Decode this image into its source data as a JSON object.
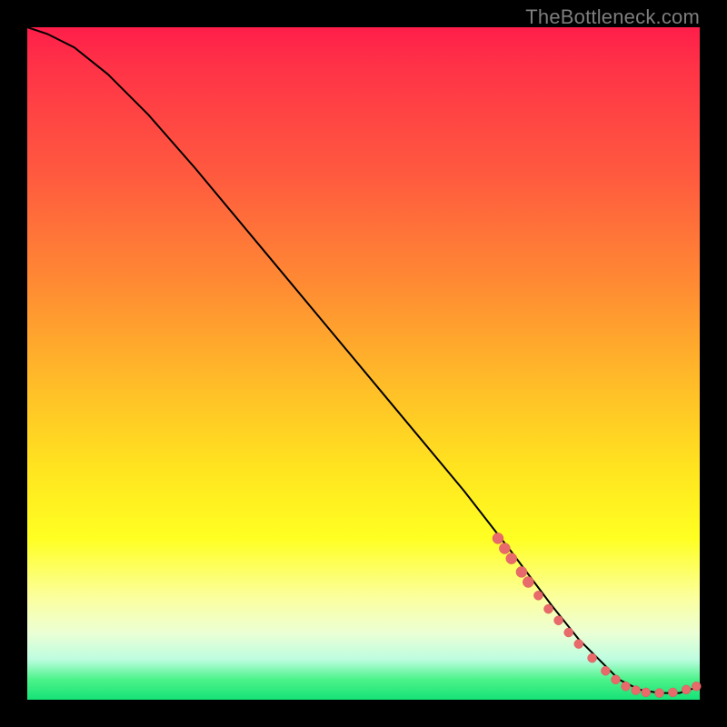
{
  "watermark": "TheBottleneck.com",
  "chart_data": {
    "type": "line",
    "title": "",
    "xlabel": "",
    "ylabel": "",
    "xlim": [
      0,
      100
    ],
    "ylim": [
      0,
      100
    ],
    "grid": false,
    "series": [
      {
        "name": "curve",
        "x": [
          0,
          3,
          7,
          12,
          18,
          25,
          35,
          45,
          55,
          65,
          72,
          78,
          82,
          85,
          88,
          91,
          94,
          97,
          100
        ],
        "y": [
          100,
          99,
          97,
          93,
          87,
          79,
          67,
          55,
          43,
          31,
          22,
          14,
          9,
          6,
          3,
          1.5,
          1,
          1,
          2
        ]
      }
    ],
    "markers": [
      {
        "x": 70,
        "y": 24,
        "r": 6
      },
      {
        "x": 71,
        "y": 22.5,
        "r": 6
      },
      {
        "x": 72,
        "y": 21,
        "r": 6
      },
      {
        "x": 73.5,
        "y": 19,
        "r": 6
      },
      {
        "x": 74.5,
        "y": 17.5,
        "r": 6
      },
      {
        "x": 76,
        "y": 15.5,
        "r": 5
      },
      {
        "x": 77.5,
        "y": 13.5,
        "r": 5
      },
      {
        "x": 79,
        "y": 11.8,
        "r": 5
      },
      {
        "x": 80.5,
        "y": 10,
        "r": 5
      },
      {
        "x": 82,
        "y": 8.3,
        "r": 5
      },
      {
        "x": 84,
        "y": 6.2,
        "r": 5
      },
      {
        "x": 86,
        "y": 4.3,
        "r": 5
      },
      {
        "x": 87.5,
        "y": 3,
        "r": 5
      },
      {
        "x": 89,
        "y": 2,
        "r": 5
      },
      {
        "x": 90.5,
        "y": 1.4,
        "r": 5
      },
      {
        "x": 92,
        "y": 1.1,
        "r": 5
      },
      {
        "x": 94,
        "y": 1,
        "r": 5
      },
      {
        "x": 96,
        "y": 1.1,
        "r": 5
      },
      {
        "x": 98,
        "y": 1.5,
        "r": 5
      },
      {
        "x": 99.5,
        "y": 2,
        "r": 5
      }
    ]
  }
}
